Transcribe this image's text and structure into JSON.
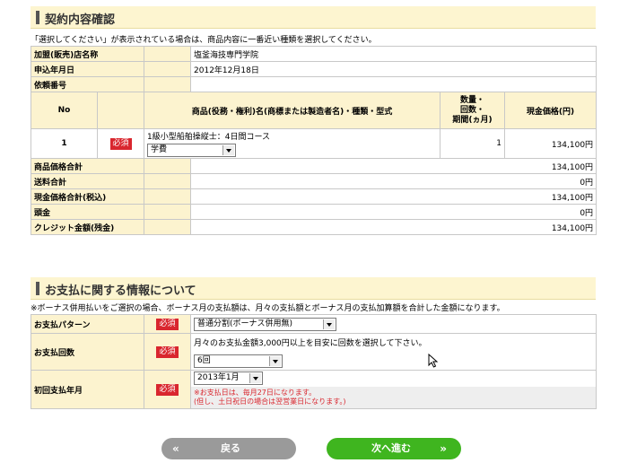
{
  "contract": {
    "title": "契約内容確認",
    "note": "「選択してください」が表示されている場合は、商品内容に一番近い種類を選択してください。",
    "rows": [
      {
        "label": "加盟(販売)店名称",
        "value": "塩釜海技専門学院"
      },
      {
        "label": "申込年月日",
        "value": "2012年12月18日"
      },
      {
        "label": "依頼番号",
        "value": ""
      }
    ],
    "header": {
      "no": "No",
      "product": "商品(役務・権利)名(商標または製造者名)・種類・型式",
      "qty": "数量・\n回数・\n期間(ヵ月)",
      "price": "現金価格(円)"
    },
    "item": {
      "no": "1",
      "required": "必須",
      "name": "1級小型船舶操縦士：4日間コース",
      "type_select": "学費",
      "qty": "1",
      "price": "134,100円"
    },
    "totals": [
      {
        "label": "商品価格合計",
        "value": "134,100円"
      },
      {
        "label": "送料合計",
        "value": "0円"
      },
      {
        "label": "現金価格合計(税込)",
        "value": "134,100円"
      },
      {
        "label": "頭金",
        "value": "0円"
      },
      {
        "label": "クレジット金額(残金)",
        "value": "134,100円"
      }
    ]
  },
  "payment": {
    "title": "お支払に関する情報について",
    "note": "※ボーナス併用払いをご選択の場合、ボーナス月の支払額は、月々の支払額とボーナス月の支払加算額を合計した金額になります。",
    "required": "必須",
    "pattern": {
      "label": "お支払パターン",
      "select": "普通分割(ボーナス併用無)"
    },
    "count": {
      "label": "お支払回数",
      "hint": "月々のお支払金額3,000円以上を目安に回数を選択して下さい。",
      "select": "6回"
    },
    "first": {
      "label": "初回支払年月",
      "select": "2013年1月",
      "note1": "※お支払日は、毎月27日になります。",
      "note2": "(但し、土日祝日の場合は翌営業日になります。)"
    }
  },
  "buttons": {
    "back": "戻る",
    "next": "次へ進む"
  },
  "colors": {
    "required": "#d9262e",
    "label_bg": "#fcf3cf",
    "back_btn": "#9a9a9a",
    "next_btn": "#3fb51f"
  }
}
